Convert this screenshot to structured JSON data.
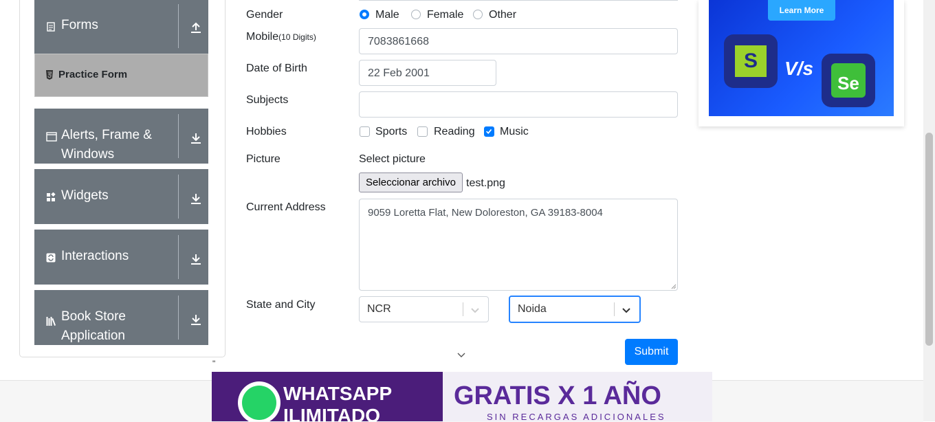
{
  "sidebar": {
    "groups": [
      {
        "label": "Forms",
        "icon": "document-icon",
        "arrow": "upload-arrow-icon"
      },
      {
        "label": "Alerts, Frame & Windows",
        "icon": "window-icon",
        "arrow": "download-arrow-icon"
      },
      {
        "label": "Widgets",
        "icon": "widgets-icon",
        "arrow": "download-arrow-icon"
      },
      {
        "label": "Interactions",
        "icon": "interactions-icon",
        "arrow": "download-arrow-icon"
      },
      {
        "label": "Book Store Application",
        "icon": "books-icon",
        "arrow": "download-arrow-icon"
      }
    ],
    "active_item": "Practice Form"
  },
  "form": {
    "gender": {
      "label": "Gender",
      "options": [
        "Male",
        "Female",
        "Other"
      ],
      "selected": "Male"
    },
    "mobile": {
      "label": "Mobile",
      "hint": "(10 Digits)",
      "value": "7083861668"
    },
    "dob": {
      "label": "Date of Birth",
      "value": "22 Feb 2001"
    },
    "subjects": {
      "label": "Subjects",
      "value": ""
    },
    "hobbies": {
      "label": "Hobbies",
      "options": [
        "Sports",
        "Reading",
        "Music"
      ],
      "checked": [
        "Music"
      ]
    },
    "picture": {
      "label": "Picture",
      "prompt": "Select picture",
      "button": "Seleccionar archivo",
      "file": "test.png"
    },
    "address": {
      "label": "Current Address",
      "value": "9059 Loretta Flat, New Doloreston, GA 39183-8004"
    },
    "state_city": {
      "label": "State and City",
      "state": "NCR",
      "city": "Noida"
    },
    "submit": "Submit"
  },
  "ads": {
    "top_button": "Learn More",
    "top_vs": "V/s",
    "bottom_left_line1": "WHATSAPP",
    "bottom_left_line2": "ILIMITADO",
    "bottom_right_line1": "GRATIS X 1 AÑO",
    "bottom_right_line2": "SIN RECARGAS ADICIONALES",
    "stray_quote": "\""
  },
  "colors": {
    "primary": "#007bff",
    "sidebar_group": "#6c757d",
    "active_item_bg": "#adadad",
    "focus_border": "#2684ff"
  }
}
